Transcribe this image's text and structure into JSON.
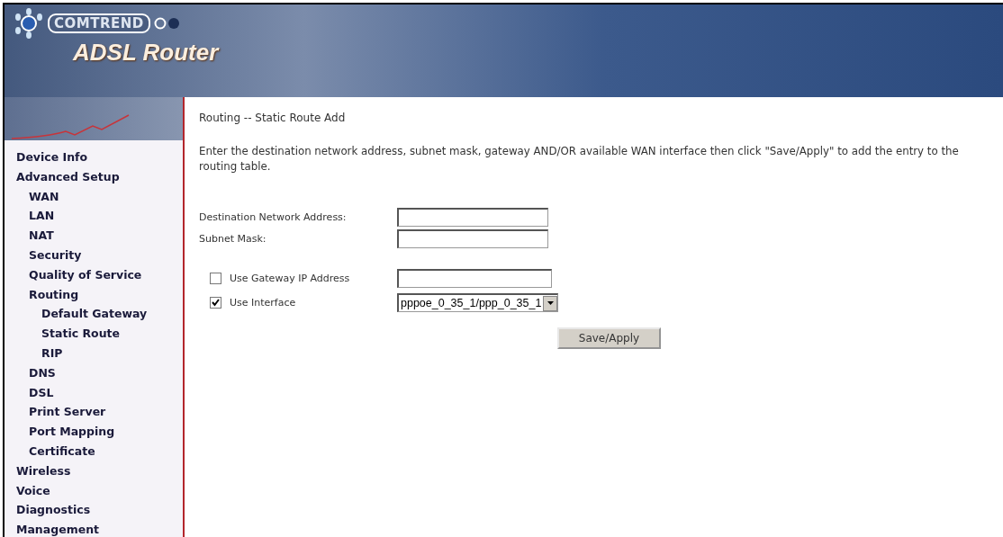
{
  "header": {
    "brand": "COMTREND",
    "product": "ADSL Router"
  },
  "sidebar": {
    "items": [
      {
        "label": "Device Info"
      },
      {
        "label": "Advanced Setup",
        "children": [
          {
            "label": "WAN"
          },
          {
            "label": "LAN"
          },
          {
            "label": "NAT"
          },
          {
            "label": "Security"
          },
          {
            "label": "Quality of Service"
          },
          {
            "label": "Routing",
            "children": [
              {
                "label": "Default Gateway"
              },
              {
                "label": "Static Route"
              },
              {
                "label": "RIP"
              }
            ]
          },
          {
            "label": "DNS"
          },
          {
            "label": "DSL"
          },
          {
            "label": "Print Server"
          },
          {
            "label": "Port Mapping"
          },
          {
            "label": "Certificate"
          }
        ]
      },
      {
        "label": "Wireless"
      },
      {
        "label": "Voice"
      },
      {
        "label": "Diagnostics"
      },
      {
        "label": "Management"
      }
    ]
  },
  "page": {
    "title": "Routing -- Static Route Add",
    "description": "Enter the destination network address, subnet mask, gateway AND/OR available WAN interface then click \"Save/Apply\" to add the entry to the routing table.",
    "fields": [
      {
        "label": "Destination Network Address:"
      },
      {
        "label": "Subnet Mask:"
      }
    ],
    "options": [
      {
        "kind": "text",
        "label": "Use Gateway IP Address",
        "checked": false
      },
      {
        "kind": "select",
        "label": "Use Interface",
        "checked": true,
        "value": "pppoe_0_35_1/ppp_0_35_1"
      }
    ],
    "button": "Save/Apply"
  }
}
